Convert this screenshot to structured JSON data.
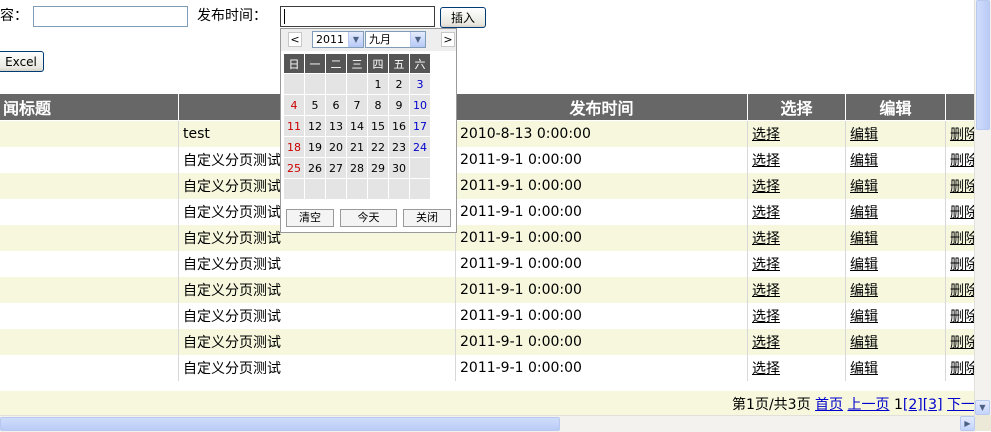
{
  "form": {
    "content_label": "容：",
    "content_value": "",
    "time_label": "发布时间：",
    "time_value": "",
    "insert_button": "插入",
    "excel_button": "Excel"
  },
  "grid": {
    "headers": [
      "闻标题",
      "",
      "发布时间",
      "选择",
      "编辑",
      ""
    ],
    "rows": [
      {
        "title": "test",
        "time": "2010-8-13 0:00:00",
        "select": "选择",
        "edit": "编辑",
        "delete": "删除"
      },
      {
        "title": "自定义分页测试",
        "time": "2011-9-1 0:00:00",
        "select": "选择",
        "edit": "编辑",
        "delete": "删除"
      },
      {
        "title": "自定义分页测试",
        "time": "2011-9-1 0:00:00",
        "select": "选择",
        "edit": "编辑",
        "delete": "删除"
      },
      {
        "title": "自定义分页测试",
        "time": "2011-9-1 0:00:00",
        "select": "选择",
        "edit": "编辑",
        "delete": "删除"
      },
      {
        "title": "自定义分页测试",
        "time": "2011-9-1 0:00:00",
        "select": "选择",
        "edit": "编辑",
        "delete": "删除"
      },
      {
        "title": "自定义分页测试",
        "time": "2011-9-1 0:00:00",
        "select": "选择",
        "edit": "编辑",
        "delete": "删除"
      },
      {
        "title": "自定义分页测试",
        "time": "2011-9-1 0:00:00",
        "select": "选择",
        "edit": "编辑",
        "delete": "删除"
      },
      {
        "title": "自定义分页测试",
        "time": "2011-9-1 0:00:00",
        "select": "选择",
        "edit": "编辑",
        "delete": "删除"
      },
      {
        "title": "自定义分页测试",
        "time": "2011-9-1 0:00:00",
        "select": "选择",
        "edit": "编辑",
        "delete": "删除"
      },
      {
        "title": "自定义分页测试",
        "time": "2011-9-1 0:00:00",
        "select": "选择",
        "edit": "编辑",
        "delete": "删除"
      }
    ]
  },
  "pager": {
    "status": "第1页/共3页",
    "first": "首页",
    "prev": "上一页",
    "current": "1",
    "page2": "[2]",
    "page3": "[3]",
    "next": "下一"
  },
  "calendar": {
    "prev": "<",
    "next": ">",
    "year": "2011",
    "month": "九月",
    "weekdays": [
      "日",
      "一",
      "二",
      "三",
      "四",
      "五",
      "六"
    ],
    "weeks": [
      [
        "",
        "",
        "",
        "",
        "1",
        "2",
        "3"
      ],
      [
        "4",
        "5",
        "6",
        "7",
        "8",
        "9",
        "10"
      ],
      [
        "11",
        "12",
        "13",
        "14",
        "15",
        "16",
        "17"
      ],
      [
        "18",
        "19",
        "20",
        "21",
        "22",
        "23",
        "24"
      ],
      [
        "25",
        "26",
        "27",
        "28",
        "29",
        "30",
        ""
      ],
      [
        "",
        "",
        "",
        "",
        "",
        "",
        ""
      ]
    ],
    "clear": "清空",
    "today": "今天",
    "close": "关闭"
  },
  "colors": {
    "header_bg": "#676767",
    "alt_row": "#f7f7de",
    "sunday": "#cc0000",
    "saturday": "#0000cc",
    "link": "#0000cc"
  }
}
